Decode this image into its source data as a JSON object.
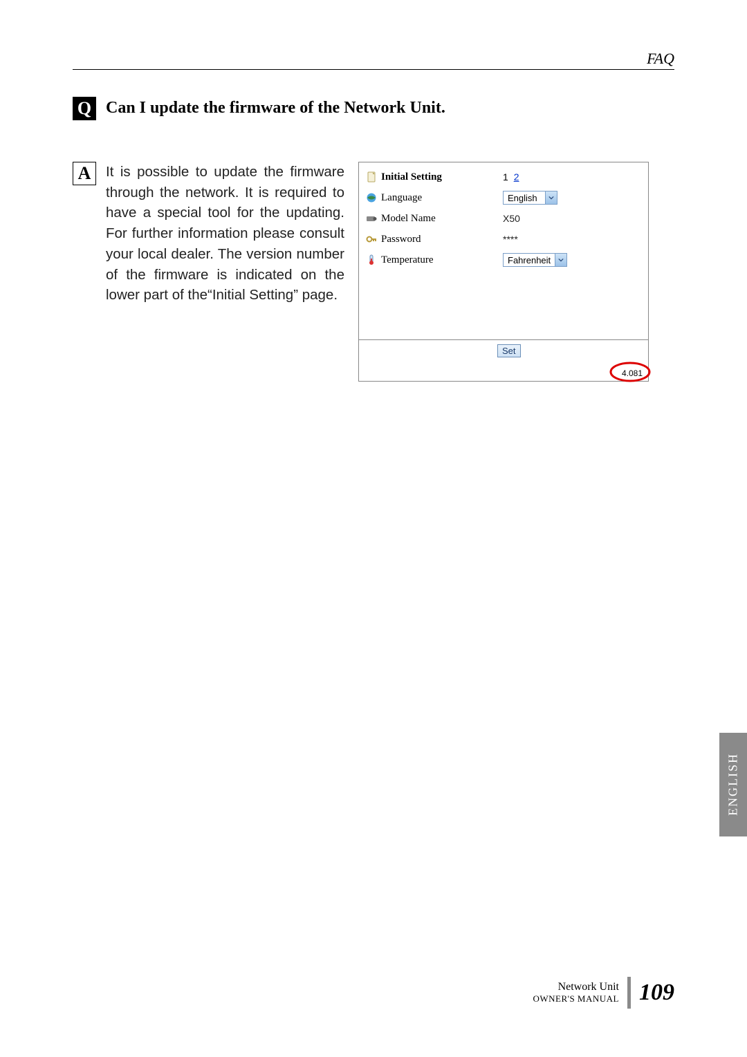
{
  "header": {
    "faq": "FAQ"
  },
  "qa": {
    "q_label": "Q",
    "a_label": "A",
    "question": "Can I update the firmware of the Network Unit.",
    "answer": "It is possible to update the firmware through the network. It is required to have a special tool for the updating. For further information please consult your local dealer. The version number of the firmware is indicated on the lower part of the“Initial Setting” page."
  },
  "settings": {
    "title": "Initial Setting",
    "pager": {
      "current": "1",
      "next": "2",
      "next_href": "#"
    },
    "rows": {
      "language": {
        "label": "Language",
        "value": "English"
      },
      "model": {
        "label": "Model Name",
        "value": "X50"
      },
      "password": {
        "label": "Password",
        "value": "****"
      },
      "temperature": {
        "label": "Temperature",
        "value": "Fahrenheit"
      }
    },
    "set_button": "Set",
    "version": "4.081"
  },
  "side_tab": "ENGLISH",
  "footer": {
    "line1": "Network Unit",
    "line2": "OWNER'S MANUAL",
    "page": "109"
  }
}
